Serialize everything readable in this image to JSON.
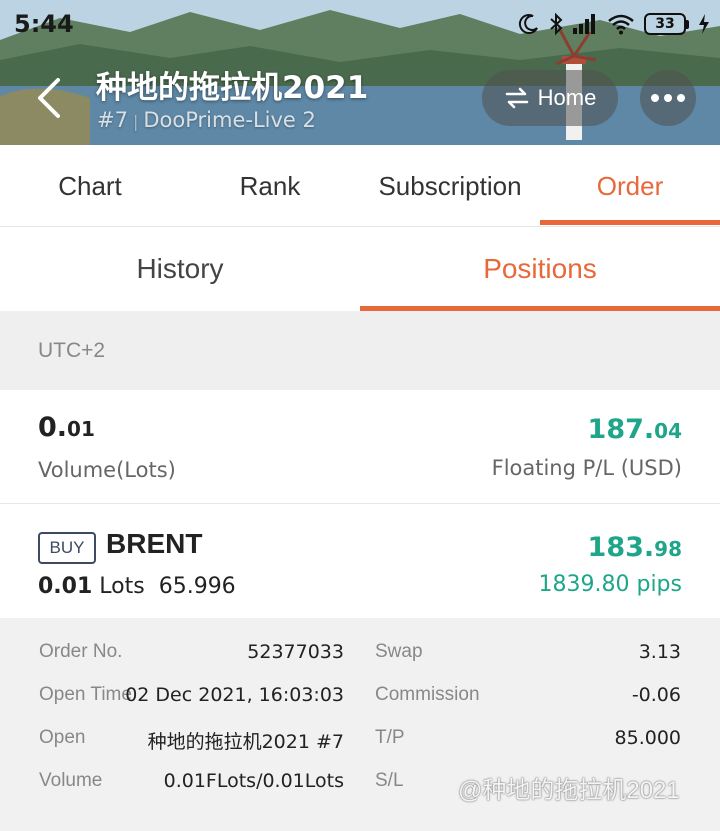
{
  "status_bar": {
    "time": "5:44",
    "battery": "33"
  },
  "header": {
    "title": "种地的拖拉机2021",
    "rank": "#7",
    "server": "DooPrime-Live 2",
    "home_label": "Home"
  },
  "main_tabs": [
    "Chart",
    "Rank",
    "Subscription",
    "Order"
  ],
  "main_tab_active": "Order",
  "sub_tabs": [
    "History",
    "Positions"
  ],
  "sub_tab_active": "Positions",
  "timezone": "UTC+2",
  "summary": {
    "volume_main": "0.",
    "volume_small": "01",
    "volume_label": "Volume(Lots)",
    "pl_main": "187.",
    "pl_small": "04",
    "pl_label": "Floating P/L (USD)"
  },
  "position": {
    "side": "BUY",
    "symbol": "BRENT",
    "lots_value": "0.01",
    "lots_unit": "Lots",
    "price": "65.996",
    "profit_main": "183.",
    "profit_small": "98",
    "pips": "1839.80 pips"
  },
  "details": {
    "order_no_label": "Order No.",
    "order_no": "52377033",
    "open_time_label": "Open Time",
    "open_time": "02 Dec 2021, 16:03:03",
    "open_label": "Open",
    "open_value": "种地的拖拉机2021  #7",
    "volume_label": "Volume",
    "volume_value": "0.01FLots/0.01Lots",
    "swap_label": "Swap",
    "swap": "3.13",
    "commission_label": "Commission",
    "commission": "-0.06",
    "tp_label": "T/P",
    "tp": "85.000",
    "sl_label": "S/L"
  },
  "watermark": "@种地的拖拉机2021",
  "colors": {
    "accent": "#e9683a",
    "profit": "#1ea58a"
  }
}
